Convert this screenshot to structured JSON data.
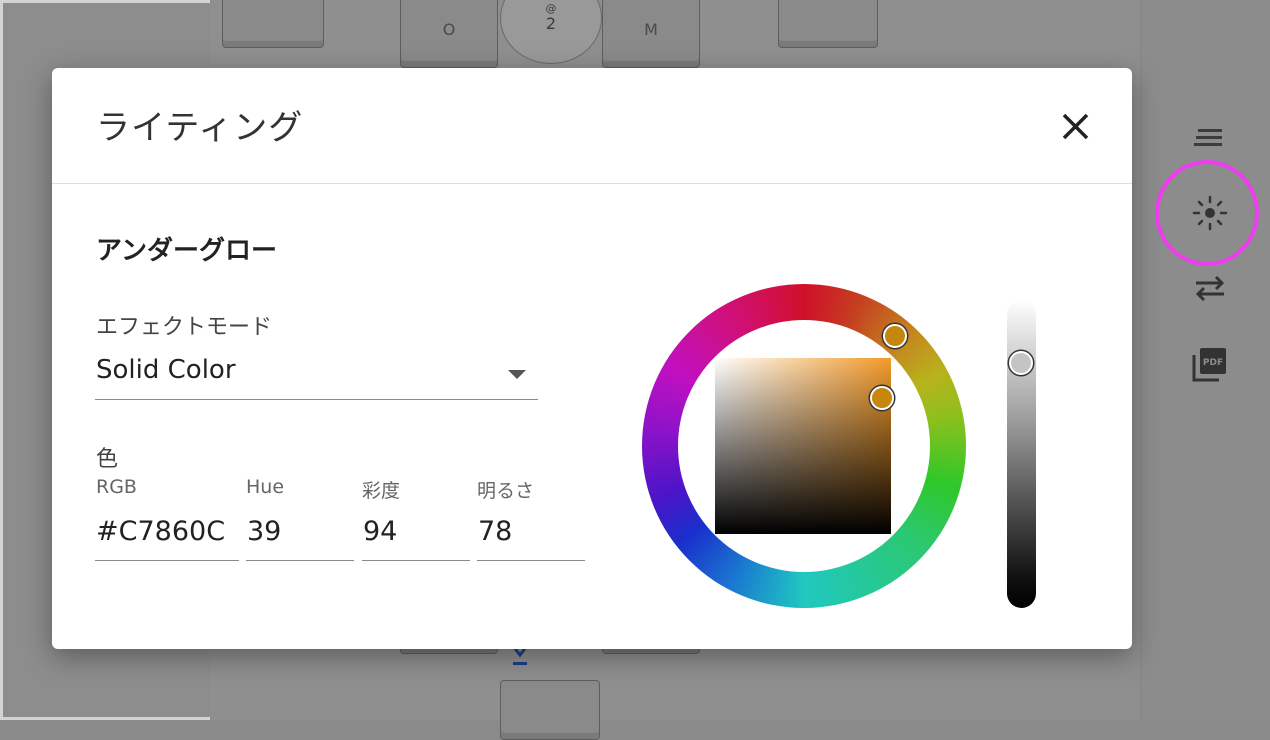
{
  "background": {
    "keys": [
      "O",
      "M"
    ],
    "dial_top": "@",
    "dial_bottom": "2"
  },
  "sidebar": {
    "items": [
      {
        "icon": "menu-lines-icon"
      },
      {
        "icon": "lighting-sun-icon",
        "highlighted": true,
        "highlight_color": "#ee3dee"
      },
      {
        "icon": "swap-arrows-icon"
      },
      {
        "icon": "pdf-icon",
        "text": "PDF"
      }
    ]
  },
  "modal": {
    "title": "ライティング",
    "close_icon": "close-icon",
    "section_title": "アンダーグロー",
    "effect_mode": {
      "label": "エフェクトモード",
      "value": "Solid Color"
    },
    "color": {
      "label": "色",
      "fields": [
        {
          "label": "RGB",
          "value": "#C7860C"
        },
        {
          "label": "Hue",
          "value": "39"
        },
        {
          "label": "彩度",
          "value": "94"
        },
        {
          "label": "明るさ",
          "value": "78"
        }
      ],
      "current_color": "#C7860C",
      "brightness_level": 0.78
    }
  }
}
